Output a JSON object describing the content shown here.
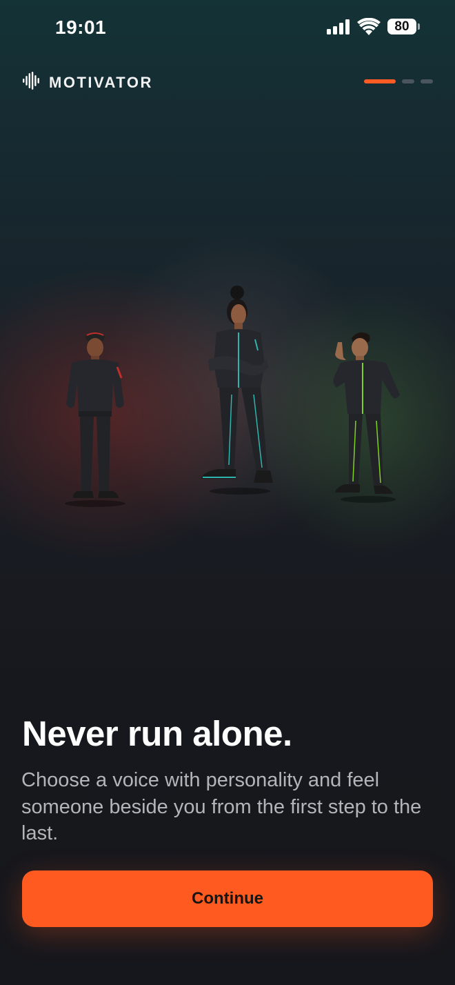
{
  "status_bar": {
    "time": "19:01",
    "battery": "80",
    "icons": [
      "cellular-signal-icon",
      "wifi-icon",
      "battery-icon"
    ]
  },
  "header": {
    "brand_icon": "sound-wave-icon",
    "brand_name": "MOTIVATOR",
    "progress": {
      "total_steps": 3,
      "current_step": 1
    }
  },
  "illustration": {
    "characters": [
      {
        "name": "coach-left",
        "accent": "#c0302a"
      },
      {
        "name": "coach-center",
        "accent": "#2fb5b0"
      },
      {
        "name": "coach-right",
        "accent": "#7ed321"
      }
    ]
  },
  "content": {
    "headline": "Never run alone.",
    "subtitle": "Choose a voice with personality and feel someone beside you from the first step to the last."
  },
  "actions": {
    "continue_label": "Continue"
  },
  "colors": {
    "accent": "#ff5a1f",
    "background": "#16171c",
    "progress_inactive": "#4a5560"
  }
}
